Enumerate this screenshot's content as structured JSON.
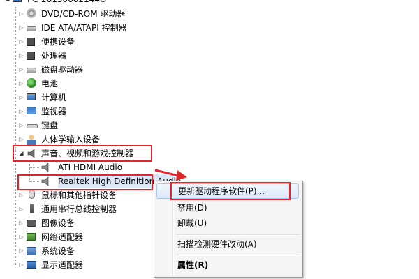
{
  "window": {
    "root_label": "PC-20150602144O"
  },
  "tree": {
    "items": [
      {
        "label": "DVD/CD-ROM 驱动器",
        "icon": "dvd-drive-icon"
      },
      {
        "label": "IDE ATA/ATAPI 控制器",
        "icon": "ide-controller-icon"
      },
      {
        "label": "便携设备",
        "icon": "portable-device-icon"
      },
      {
        "label": "处理器",
        "icon": "processor-icon"
      },
      {
        "label": "磁盘驱动器",
        "icon": "disk-drive-icon"
      },
      {
        "label": "电池",
        "icon": "battery-icon"
      },
      {
        "label": "计算机",
        "icon": "computer-icon"
      },
      {
        "label": "监视器",
        "icon": "monitor-icon"
      },
      {
        "label": "键盘",
        "icon": "keyboard-icon"
      },
      {
        "label": "人体学输入设备",
        "icon": "hid-icon"
      },
      {
        "label": "声音、视频和游戏控制器",
        "icon": "speaker-icon",
        "expanded": true
      },
      {
        "label": "ATI HDMI Audio",
        "icon": "speaker-icon",
        "child": true
      },
      {
        "label": "Realtek High Definition Audio",
        "icon": "speaker-icon",
        "child": true,
        "selected": true
      },
      {
        "label": "鼠标和其他指针设备",
        "icon": "mouse-icon"
      },
      {
        "label": "通用串行总线控制器",
        "icon": "usb-icon"
      },
      {
        "label": "图像设备",
        "icon": "camera-icon"
      },
      {
        "label": "网络适配器",
        "icon": "network-adapter-icon"
      },
      {
        "label": "系统设备",
        "icon": "system-device-icon"
      },
      {
        "label": "显示适配器",
        "icon": "display-adapter-icon"
      }
    ]
  },
  "context_menu": {
    "update_driver": "更新驱动程序软件(P)...",
    "disable": "禁用(D)",
    "uninstall": "卸载(U)",
    "scan": "扫描检测硬件改动(A)",
    "properties": "属性(R)"
  },
  "colors": {
    "annotation_red": "#e0262a",
    "menu_bg": "#f5f5f5",
    "hover_border": "#a8c7f0"
  }
}
